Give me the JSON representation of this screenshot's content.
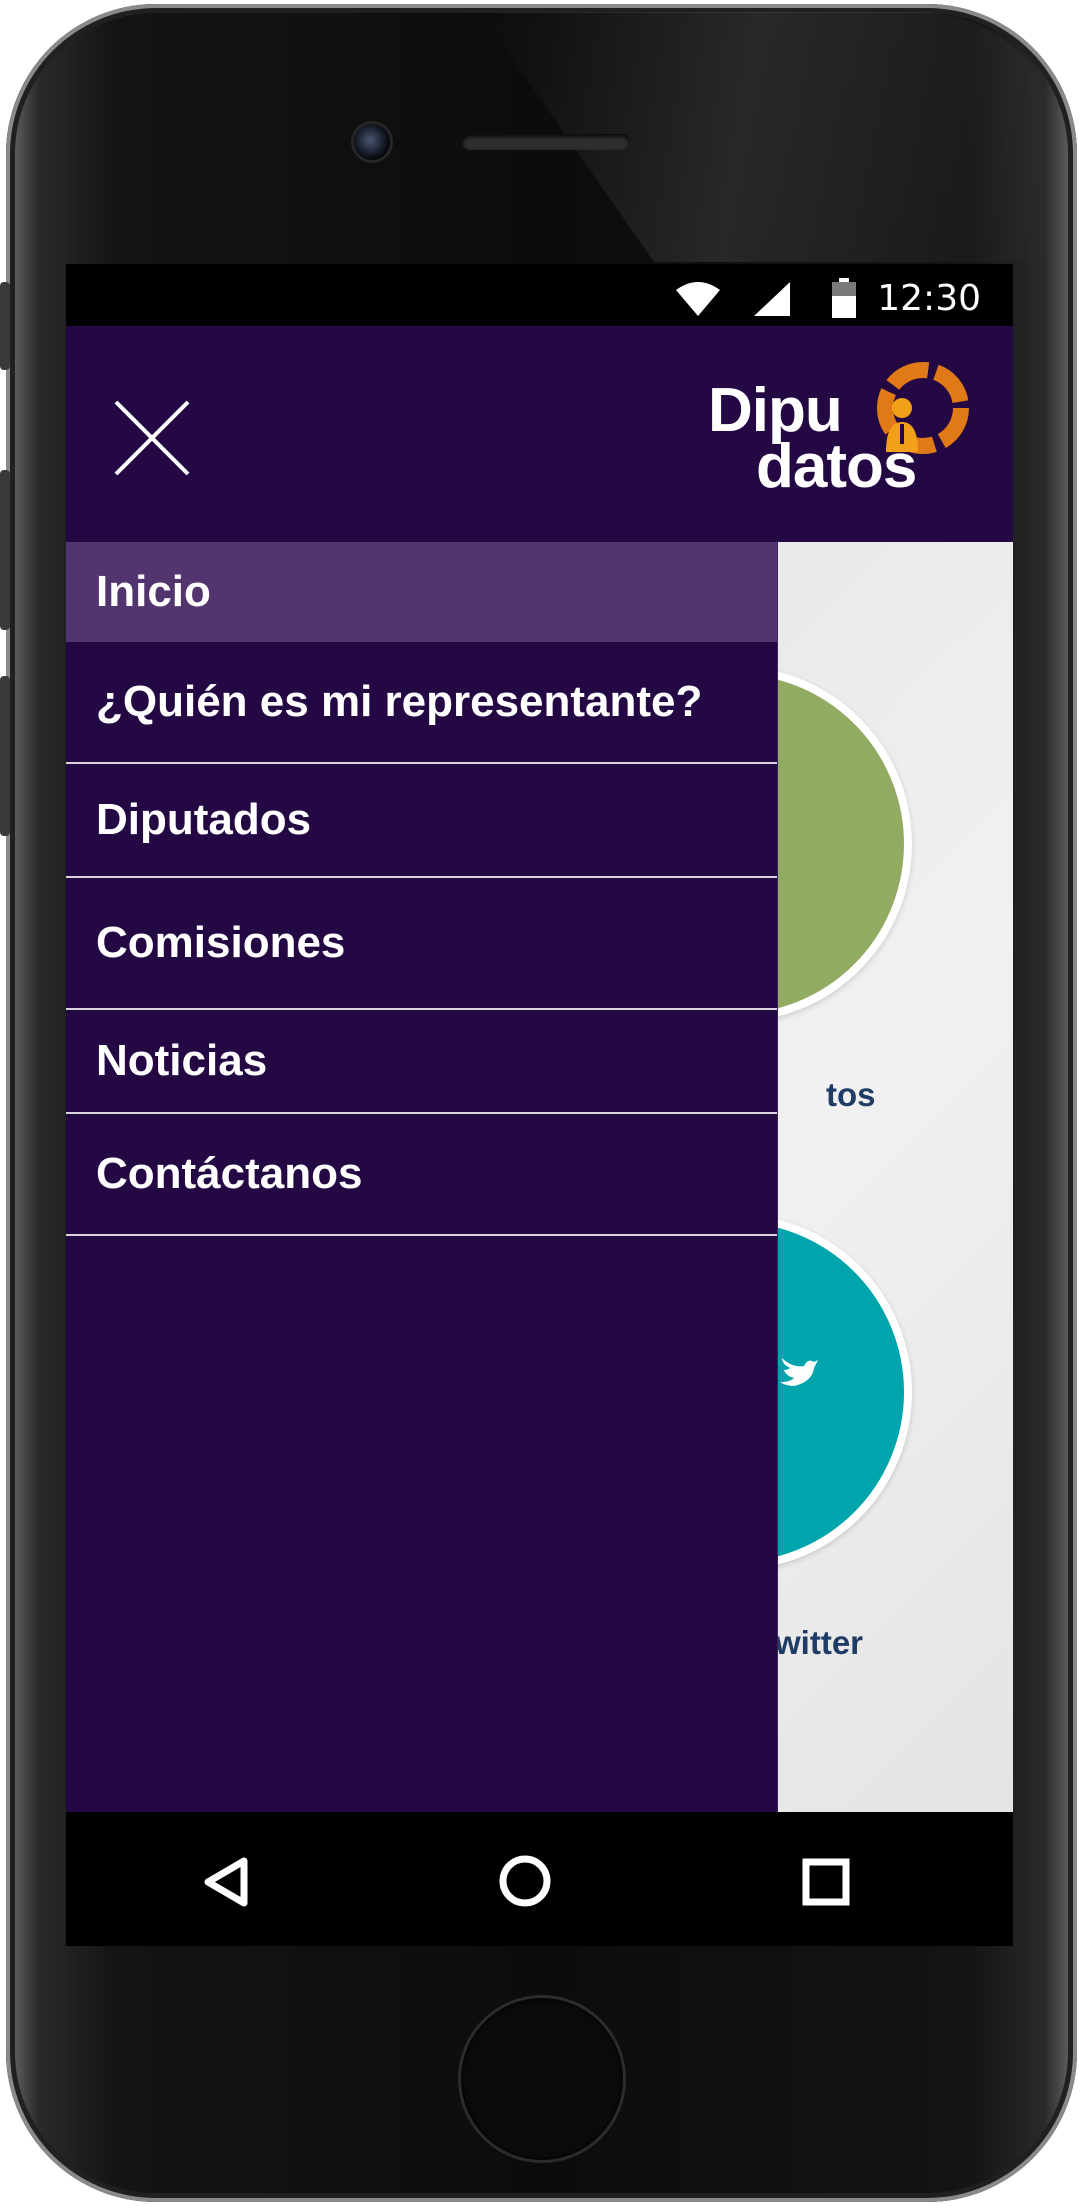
{
  "status_bar": {
    "time": "12:30",
    "wifi_icon": "wifi-icon",
    "signal_icon": "signal-icon",
    "battery_icon": "battery-icon"
  },
  "header": {
    "close_icon": "close-icon",
    "logo": {
      "line1": "Dipu",
      "line2": "datos"
    },
    "colors": {
      "header_bg": "#240844",
      "logo_accent": "#e07a16"
    }
  },
  "menu": {
    "items": [
      {
        "label": "Inicio",
        "active": true
      },
      {
        "label": "¿Quién es mi representante?",
        "active": false
      },
      {
        "label": "Diputados",
        "active": false
      },
      {
        "label": "Comisiones",
        "active": false
      },
      {
        "label": "Noticias",
        "active": false
      },
      {
        "label": "Contáctanos",
        "active": false
      }
    ],
    "colors": {
      "drawer_bg": "#240844",
      "active_bg": "#52356e"
    }
  },
  "background_tiles": [
    {
      "label_fragment": "tos",
      "color": "#92ab62"
    },
    {
      "label_fragment": "witter",
      "color": "#00a4ac"
    }
  ],
  "nav_bar": {
    "back_icon": "back-triangle-icon",
    "home_icon": "home-circle-icon",
    "recent_icon": "recent-square-icon"
  }
}
